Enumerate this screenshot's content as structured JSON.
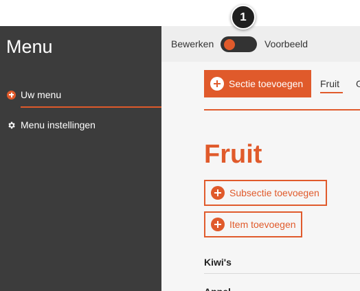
{
  "step": {
    "number": "1"
  },
  "sidebar": {
    "title": "Menu",
    "items": [
      {
        "label": "Uw menu",
        "icon": "plus-circle-icon",
        "active": true
      },
      {
        "label": "Menu instellingen",
        "icon": "gear-icon",
        "active": false
      }
    ]
  },
  "toolbar": {
    "edit_label": "Bewerken",
    "preview_label": "Voorbeeld",
    "toggle_state": "edit"
  },
  "main": {
    "add_section_label": "Sectie toevoegen",
    "tabs": [
      {
        "label": "Fruit",
        "active": true
      },
      {
        "label": "G",
        "active": false
      }
    ],
    "section_title": "Fruit",
    "add_subsection_label": "Subsectie toevoegen",
    "add_item_label": "Item toevoegen",
    "items": [
      {
        "name": "Kiwi's"
      },
      {
        "name": "Appel"
      }
    ]
  },
  "colors": {
    "accent": "#e05a2b",
    "sidebar_bg": "#3c3c3c",
    "toolbar_bg": "#eeeeee"
  }
}
